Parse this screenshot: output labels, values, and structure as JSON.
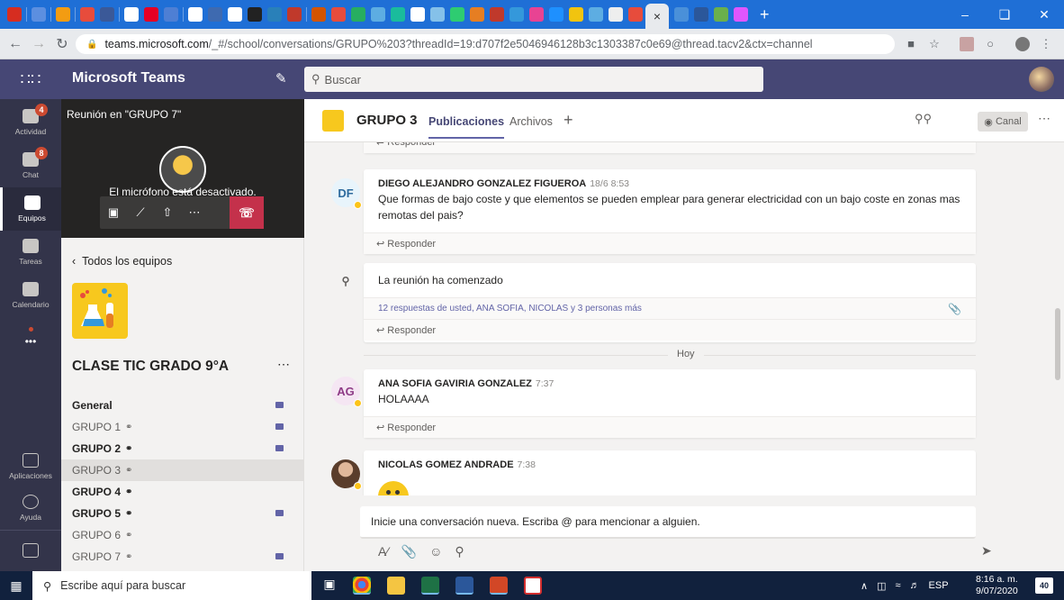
{
  "browser": {
    "url_host": "teams.microsoft.com",
    "url_path": "/_#/school/conversations/GRUPO%203?threadId=19:d707f2e5046946128b3c1303387c0e69@thread.tacv2&ctx=channel",
    "active_tab_close": "×",
    "new_tab": "+"
  },
  "header": {
    "app_name": "Microsoft Teams",
    "search_placeholder": "Buscar"
  },
  "rail": {
    "items": [
      {
        "label": "Actividad",
        "badge": "4",
        "icon": "bell-icon"
      },
      {
        "label": "Chat",
        "badge": "8",
        "icon": "chat-icon"
      },
      {
        "label": "Equipos",
        "badge": "",
        "icon": "teams-icon"
      },
      {
        "label": "Tareas",
        "badge": "",
        "icon": "tasks-icon"
      },
      {
        "label": "Calendario",
        "badge": "",
        "icon": "calendar-icon"
      }
    ],
    "more": "•••",
    "bottom": [
      {
        "label": "Aplicaciones",
        "icon": "apps-icon"
      },
      {
        "label": "Ayuda",
        "icon": "help-icon"
      }
    ]
  },
  "meeting": {
    "title": "Reunión en \"GRUPO 7\"",
    "mute_note": "El micrófono está desactivado."
  },
  "panel": {
    "all_teams": "Todos los equipos",
    "team_name": "CLASE TIC GRADO 9°A",
    "channels": [
      {
        "name": "General",
        "bold": true,
        "locked": false,
        "selected": false,
        "camera": true
      },
      {
        "name": "GRUPO 1",
        "bold": false,
        "locked": true,
        "selected": false,
        "camera": true
      },
      {
        "name": "GRUPO 2",
        "bold": true,
        "locked": true,
        "selected": false,
        "camera": true
      },
      {
        "name": "GRUPO 3",
        "bold": false,
        "locked": true,
        "selected": true,
        "camera": false
      },
      {
        "name": "GRUPO 4",
        "bold": true,
        "locked": true,
        "selected": false,
        "camera": false
      },
      {
        "name": "GRUPO 5",
        "bold": true,
        "locked": true,
        "selected": false,
        "camera": true
      },
      {
        "name": "GRUPO 6",
        "bold": false,
        "locked": true,
        "selected": false,
        "camera": false
      },
      {
        "name": "GRUPO 7",
        "bold": false,
        "locked": true,
        "selected": false,
        "camera": true
      }
    ]
  },
  "channel": {
    "name": "GRUPO 3",
    "tab_posts": "Publicaciones",
    "tab_files": "Archivos",
    "tab_add": "+",
    "canal_button": "Canal"
  },
  "feed": {
    "reply_label": "Responder",
    "post1": {
      "initials": "DF",
      "author": "DIEGO ALEJANDRO GONZALEZ FIGUEROA",
      "time": "18/6 8:53",
      "text": "Que formas de bajo coste y que elementos se pueden emplear para generar electricidad con un bajo coste en zonas mas remotas del pais?"
    },
    "meeting_post": {
      "title": "La reunión ha comenzado",
      "replies": "12 respuestas de usted, ANA SOFIA, NICOLAS y 3 personas más"
    },
    "divider": "Hoy",
    "post2": {
      "initials": "AG",
      "author": "ANA SOFIA GAVIRIA GONZALEZ",
      "time": "7:37",
      "text": "HOLAAAA"
    },
    "post3": {
      "author": "NICOLAS GOMEZ ANDRADE",
      "time": "7:38"
    }
  },
  "compose": {
    "placeholder": "Inicie una conversación nueva. Escriba @ para mencionar a alguien."
  },
  "taskbar": {
    "search_placeholder": "Escribe aquí para buscar",
    "lang": "ESP",
    "time": "8:16 a. m.",
    "date": "9/07/2020",
    "notifications": "40"
  },
  "colors": {
    "teams_purple": "#464775",
    "accent": "#6264a7",
    "rail_bg": "#33344a",
    "badge_red": "#cc4a31",
    "hangup_red": "#c4314b"
  }
}
